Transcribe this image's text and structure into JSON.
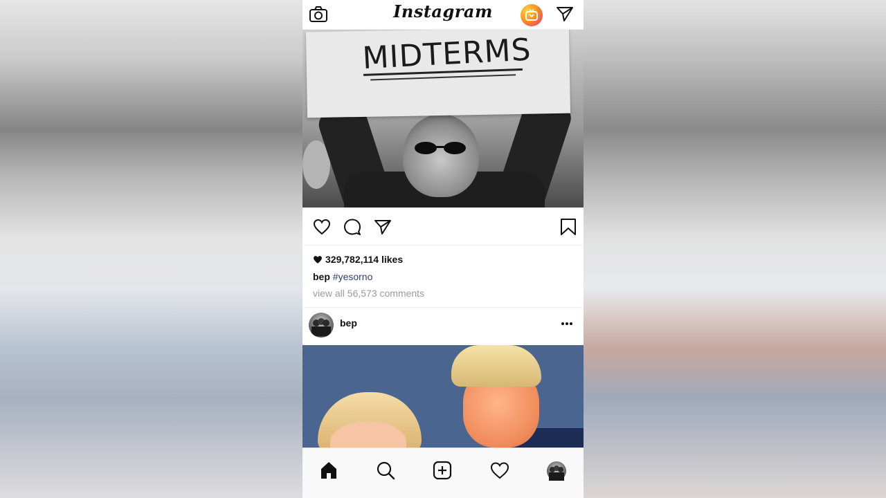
{
  "header": {
    "logo_text": "Instagram",
    "icons": [
      "camera-icon",
      "igtv-icon",
      "direct-message-icon"
    ]
  },
  "post1": {
    "image_sign_text": "MIDTERMS",
    "likes": "329,782,114 likes",
    "caption_user": "bep",
    "caption_tag": "#yesorno",
    "view_comments": "view all 56,573 comments",
    "actions": [
      "like-icon",
      "comment-icon",
      "share-icon",
      "bookmark-icon"
    ]
  },
  "post2": {
    "username": "bep"
  },
  "bottom_nav": {
    "items": [
      "home-icon",
      "search-icon",
      "add-post-icon",
      "activity-icon",
      "profile-icon"
    ]
  },
  "colors": {
    "hashtag": "#2c3e7a",
    "muted_text": "#9a9a9a",
    "igtv_gradient": [
      "#ffd24a",
      "#f7931e",
      "#ee2a7b"
    ]
  }
}
